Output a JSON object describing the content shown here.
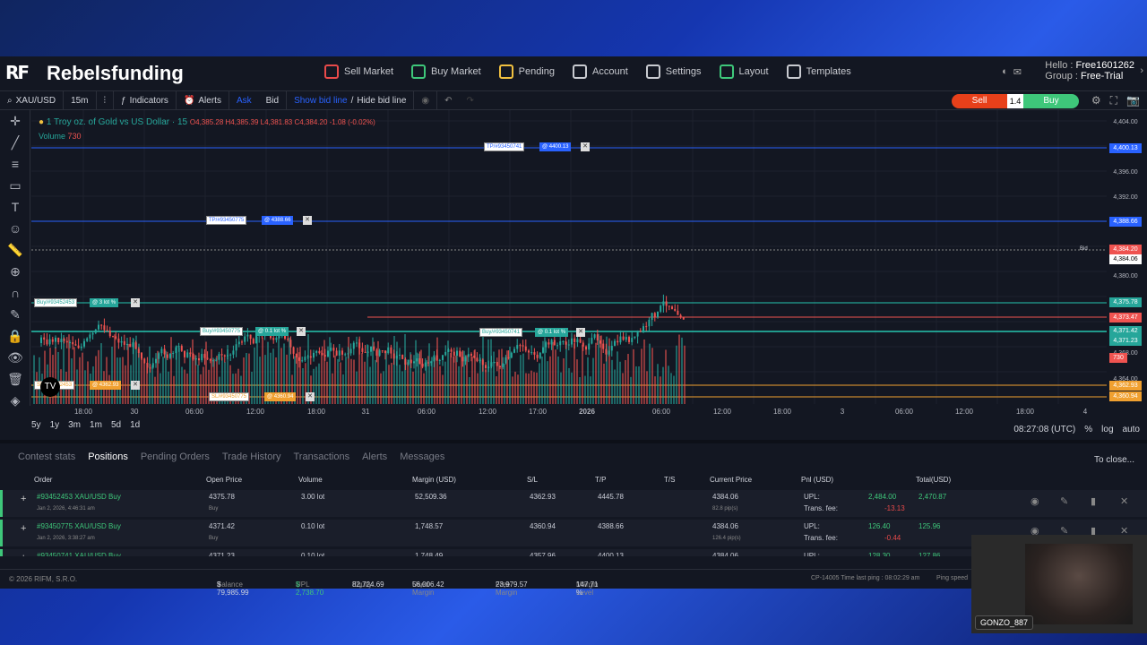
{
  "brand": {
    "logo_mark": "RF",
    "name": "Rebelsfunding"
  },
  "menu": [
    {
      "label": "Sell Market",
      "icon": "sell-market-icon",
      "color": "#e84a4a"
    },
    {
      "label": "Buy Market",
      "icon": "buy-market-icon",
      "color": "#3ec77a"
    },
    {
      "label": "Pending",
      "icon": "pending-icon",
      "color": "#f0c040"
    },
    {
      "label": "Account",
      "icon": "account-icon",
      "color": "#c8cad0"
    },
    {
      "label": "Settings",
      "icon": "settings-icon",
      "color": "#c8cad0"
    },
    {
      "label": "Layout",
      "icon": "layout-icon",
      "color": "#3ec77a"
    },
    {
      "label": "Templates",
      "icon": "templates-icon",
      "color": "#c8cad0"
    }
  ],
  "user": {
    "hello_label": "Hello :",
    "name": "Free1601262",
    "group_label": "Group :",
    "group": "Free-Trial"
  },
  "toolbar": {
    "symbol": "XAU/USD",
    "interval": "15m",
    "indicators": "Indicators",
    "alerts": "Alerts",
    "ask": "Ask",
    "bid": "Bid",
    "show_bid_line": "Show bid line",
    "separator": "/",
    "hide_bid_line": "Hide bid line",
    "sell": "Sell",
    "spread": "1.4",
    "buy": "Buy"
  },
  "chart": {
    "title": "1 Troy oz. of Gold vs US Dollar · 15",
    "ohlc": {
      "o_label": "O",
      "o": "4,385.28",
      "h_label": "H",
      "h": "4,385.39",
      "l_label": "L",
      "l": "4,381.83",
      "c_label": "C",
      "c": "4,384.20",
      "change": "-1.08 (-0.02%)"
    },
    "volume_label": "Volume",
    "volume": "730",
    "price_axis": [
      "4,404.00",
      "4,400.13",
      "4,396.00",
      "4,392.00",
      "4,388.66",
      "4,384.20",
      "4,384.06",
      "4,380.00",
      "4,375.78",
      "4,373.47",
      "4,371.42",
      "4,371.23",
      "4,368.00",
      "730",
      "4,364.00",
      "4,362.93",
      "4,360.94"
    ],
    "time_axis": [
      "18:00",
      "30",
      "06:00",
      "12:00",
      "18:00",
      "31",
      "06:00",
      "12:00",
      "17:00",
      "2026",
      "06:00",
      "12:00",
      "18:00",
      "3",
      "06:00",
      "12:00",
      "18:00",
      "4"
    ],
    "bid_label": "Bid",
    "order_lines": [
      {
        "label": "TP/#93450741",
        "value": "@ 4400.13",
        "kind": "tp"
      },
      {
        "label": "TP/#93450775",
        "value": "@ 4388.66",
        "kind": "tp"
      },
      {
        "label": "Buy/#93452453",
        "value": "@ 3 lot %",
        "kind": "buy"
      },
      {
        "label": "Buy/#93450775",
        "value": "@ 0.1 lot %",
        "kind": "buy"
      },
      {
        "label": "Buy/#93450741",
        "value": "@ 0.1 lot %",
        "kind": "buy"
      },
      {
        "label": "SL/#93452453",
        "value": "@ 4362.93",
        "kind": "sl"
      },
      {
        "label": "SL/#93450775",
        "value": "@ 4360.94",
        "kind": "sl"
      }
    ]
  },
  "timeframes": [
    "5y",
    "1y",
    "3m",
    "1m",
    "5d",
    "1d"
  ],
  "clock": {
    "time": "08:27:08 (UTC)",
    "percent": "%",
    "log": "log",
    "auto": "auto"
  },
  "tabs": [
    "Contest stats",
    "Positions",
    "Pending Orders",
    "Trade History",
    "Transactions",
    "Alerts",
    "Messages"
  ],
  "close_all": "To close...",
  "columns": [
    "Order",
    "Open Price",
    "Volume",
    "Margin (USD)",
    "S/L",
    "T/P",
    "T/S",
    "Current Price",
    "Pnl (USD)",
    "Total(USD)"
  ],
  "positions": [
    {
      "order": "#93452453 XAU/USD Buy",
      "date": "Jan 2, 2026, 4:46:31 am",
      "open": "4375.78",
      "side": "Buy",
      "volume": "3.00 lot",
      "margin": "52,509.36",
      "sl": "4362.93",
      "tp": "4445.78",
      "current": "4384.06",
      "pips": "82.8 pip(s)",
      "upl_label": "UPL:",
      "upl": "2,484.00",
      "fee_label": "Trans. fee:",
      "fee": "-13.13",
      "total": "2,470.87"
    },
    {
      "order": "#93450775 XAU/USD Buy",
      "date": "Jan 2, 2026, 3:38:27 am",
      "open": "4371.42",
      "side": "Buy",
      "volume": "0.10 lot",
      "margin": "1,748.57",
      "sl": "4360.94",
      "tp": "4388.66",
      "current": "4384.06",
      "pips": "126.4 pip(s)",
      "upl_label": "UPL:",
      "upl": "126.40",
      "fee_label": "Trans. fee:",
      "fee": "-0.44",
      "total": "125.96"
    },
    {
      "order": "#93450741 XAU/USD Buy",
      "date": "",
      "open": "4371.23",
      "side": "",
      "volume": "0.10 lot",
      "margin": "1,748.49",
      "sl": "4357.96",
      "tp": "4400.13",
      "current": "4384.06",
      "pips": "",
      "upl_label": "UPL:",
      "upl": "128.30",
      "fee_label": "",
      "fee": "",
      "total": "127.86"
    }
  ],
  "status": {
    "copyright": "© 2026 RIFM, S.R.O.",
    "balance_label": "Balance",
    "balance": "$ 79,985.99",
    "upl_label": "UPL",
    "upl": "$ 2,738.70",
    "equity_label": "Equity",
    "equity": "82,724.69",
    "used_margin_label": "Used Margin",
    "used_margin": "56,006.42",
    "free_margin_label": "Free Margin",
    "free_margin": "23,979.57",
    "margin_level_label": "Margin Level",
    "margin_level": "147.71 %",
    "server": "CP-14005 Time last ping : 08:02:29 am",
    "ping_label": "Ping speed"
  },
  "webcam": {
    "username": "GONZO_887"
  },
  "colors": {
    "up": "#26a69a",
    "down": "#ef5350",
    "tp_line": "#2962ff",
    "sl_line": "#f0a030",
    "entry_line": "#26c6b0",
    "bg": "#131722"
  }
}
